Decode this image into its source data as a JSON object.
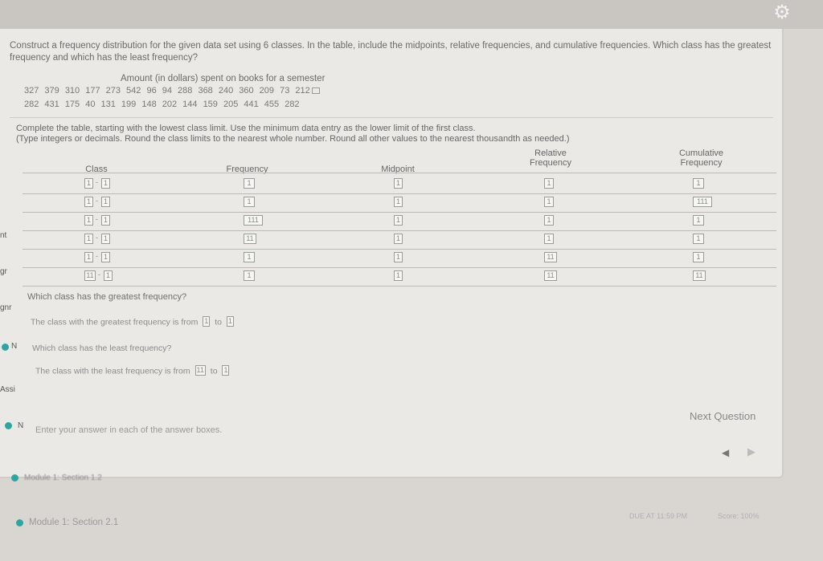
{
  "question": {
    "text": "Construct a frequency distribution for the given data set using 6 classes. In the table, include the midpoints, relative frequencies, and cumulative frequencies. Which class has the greatest frequency and which has the least frequency?",
    "data_title": "Amount (in dollars) spent on books for a semester",
    "data_row1": "327 379 310 177 273 542 96 94 288 368 240 360 209 73 212",
    "data_row2": "282 431 175 40 131 199 148 202 144 159 205 441 455 282"
  },
  "instructions": {
    "line1": "Complete the table, starting with the lowest class limit. Use the minimum data entry as the lower limit of the first class.",
    "line2": "(Type integers or decimals. Round the class limits to the nearest whole number. Round all other values to the nearest thousandth as needed.)"
  },
  "table": {
    "headers": {
      "class": "Class",
      "frequency": "Frequency",
      "midpoint": "Midpoint",
      "relative_frequency": "Relative Frequency",
      "cumulative_frequency": "Cumulative Frequency"
    },
    "rows": [
      {
        "class_lower": "1",
        "class_upper": "1",
        "frequency": "1",
        "midpoint": "1",
        "relative": "1",
        "cumulative": "1"
      },
      {
        "class_lower": "1",
        "class_upper": "1",
        "frequency": "1",
        "midpoint": "1",
        "relative": "1",
        "cumulative": "111"
      },
      {
        "class_lower": "1",
        "class_upper": "1",
        "frequency": "111",
        "midpoint": "1",
        "relative": "1",
        "cumulative": "1"
      },
      {
        "class_lower": "1",
        "class_upper": "1",
        "frequency": "11",
        "midpoint": "1",
        "relative": "1",
        "cumulative": "1"
      },
      {
        "class_lower": "1",
        "class_upper": "1",
        "frequency": "1",
        "midpoint": "1",
        "relative": "11",
        "cumulative": "1"
      },
      {
        "class_lower": "11",
        "class_upper": "1",
        "frequency": "1",
        "midpoint": "1",
        "relative": "11",
        "cumulative": "11"
      }
    ]
  },
  "greatest": {
    "question": "Which class has the greatest frequency?",
    "answer_prefix": "The class with the greatest frequency is from",
    "box1": "1",
    "to": "to",
    "box2": "1"
  },
  "least": {
    "question": "Which class has the least frequency?",
    "answer_prefix": "The class with the least frequency is from",
    "box1": "11",
    "to": "to",
    "box2": "1"
  },
  "footer": {
    "hint": "Enter your answer in each of the answer boxes.",
    "next_question": "Next Question",
    "prev_arrow": "◀",
    "next_arrow": "▶",
    "blurred_module": "Module 1: Section 1.2",
    "module_link": "Module 1: Section 2.1",
    "due": "DUE AT 11:59 PM",
    "score": "Score: 100%"
  },
  "side_fragments": [
    "nt",
    "gr",
    "gnr",
    "N",
    "Assi",
    "N"
  ],
  "colors": {
    "accent": "#2ea6a0",
    "panel": "#ebe9e6",
    "background": "#d9d6d2"
  },
  "icons": {
    "settings": "gear-icon",
    "expand": "expand-data-icon",
    "status": "status-dot-icon"
  }
}
